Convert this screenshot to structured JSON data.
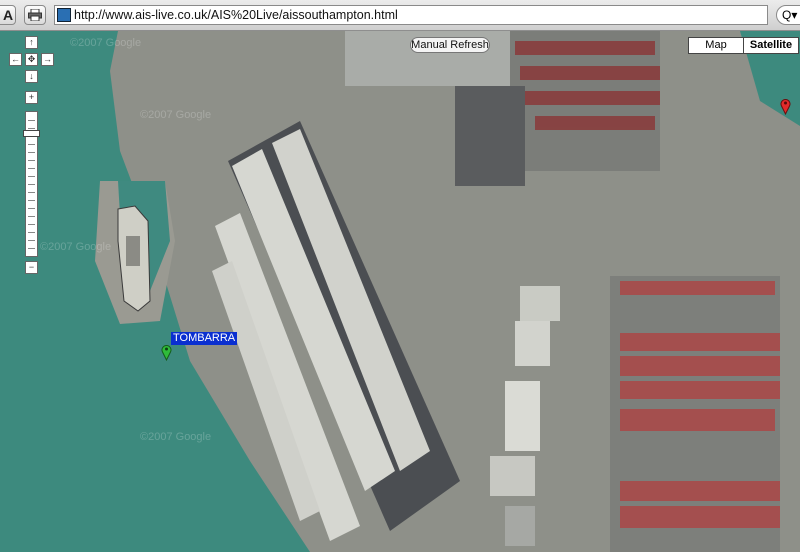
{
  "browser": {
    "text_size_button": "A",
    "url": "http://www.ais-live.co.uk/AIS%20Live/aissouthampton.html",
    "search_glyph": "Q▾"
  },
  "map": {
    "buttons": {
      "manual_refresh": "Manual Refresh",
      "map_type_map": "Map",
      "map_type_satellite": "Satellite"
    },
    "vessel_label": "TOMBARRA",
    "watermark": "©2007 Google",
    "colors": {
      "water": "#3d8a7e",
      "quay": "#8e9089",
      "shed_roof_light": "#d6d7d1",
      "shed_roof_dark": "#4b4e52",
      "vessel_label_bg": "#0a2fd0",
      "green_marker": "#2fbb3a",
      "red_marker": "#e32a2a"
    }
  }
}
